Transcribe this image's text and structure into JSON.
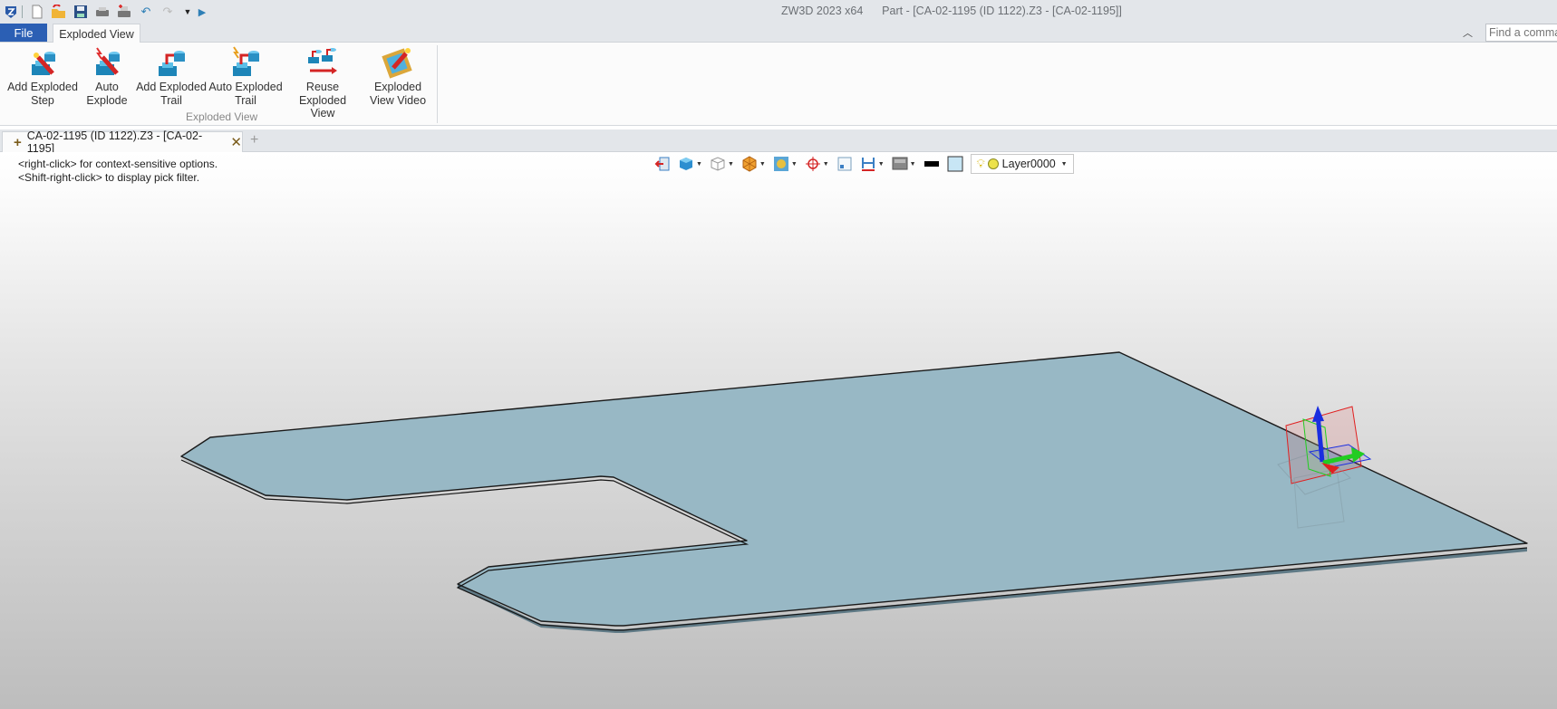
{
  "titlebar": {
    "app_name": "ZW3D 2023 x64",
    "document": "Part - [CA-02-1195 (ID 1122).Z3 - [CA-02-1195]]",
    "quick_access": [
      {
        "name": "app-logo-icon"
      },
      {
        "name": "new-file-icon"
      },
      {
        "name": "open-file-icon"
      },
      {
        "name": "save-icon"
      },
      {
        "name": "print-icon"
      },
      {
        "name": "print-preview-icon"
      },
      {
        "name": "undo-icon"
      },
      {
        "name": "redo-icon"
      },
      {
        "name": "customize-dropdown-icon"
      },
      {
        "name": "more-arrow-icon"
      }
    ]
  },
  "ribbon": {
    "tabs": [
      {
        "label": "File",
        "active": false
      },
      {
        "label": "Exploded View",
        "active": true
      }
    ],
    "search_placeholder": "Find a command",
    "group_label": "Exploded View",
    "buttons": [
      {
        "line1": "Add Exploded",
        "line2": "Step",
        "icon": "add-exploded-step-icon"
      },
      {
        "line1": "Auto",
        "line2": "Explode",
        "icon": "auto-explode-icon"
      },
      {
        "line1": "Add Exploded",
        "line2": "Trail",
        "icon": "add-exploded-trail-icon"
      },
      {
        "line1": "Auto Exploded",
        "line2": "Trail",
        "icon": "auto-exploded-trail-icon"
      },
      {
        "line1": "Reuse Exploded",
        "line2": "View",
        "icon": "reuse-exploded-view-icon"
      },
      {
        "line1": "Exploded",
        "line2": "View Video",
        "icon": "exploded-view-video-icon"
      }
    ]
  },
  "document_tab": {
    "label": "CA-02-1195 (ID 1122).Z3 - [CA-02-1195]",
    "close_glyph": "✕",
    "new_tab_glyph": "+"
  },
  "viewport": {
    "hint_line1": "<right-click> for context-sensitive options.",
    "hint_line2": "<Shift-right-click> to display pick filter.",
    "toolbar": {
      "layer_name": "Layer0000",
      "items": [
        "exit-icon",
        "shaded-cube-icon",
        "wireframe-cube-icon",
        "render-mode-icon",
        "view-fit-icon",
        "pick-target-icon",
        "zoom-window-icon",
        "dimension-icon",
        "background-icon",
        "line-color-icon",
        "face-color-icon"
      ]
    },
    "colors": {
      "plate_face": "#98b8c5",
      "plate_edge": "#1a1a1a",
      "axis_x": "#e02020",
      "axis_y": "#22cc22",
      "axis_z": "#1a2ee0"
    }
  }
}
